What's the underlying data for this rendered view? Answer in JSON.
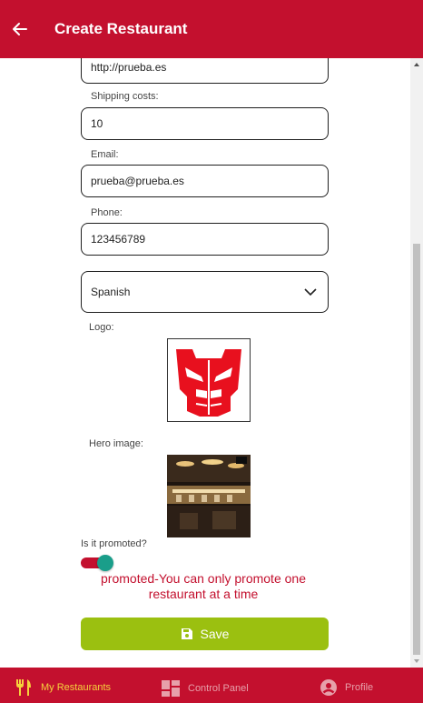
{
  "header": {
    "title": "Create Restaurant"
  },
  "form": {
    "url_value": "http://prueba.es",
    "shipping_label": "Shipping costs:",
    "shipping_value": "10",
    "email_label": "Email:",
    "email_value": "prueba@prueba.es",
    "phone_label": "Phone:",
    "phone_value": "123456789",
    "category_value": "Spanish",
    "logo_label": "Logo:",
    "hero_label": "Hero image:",
    "promoted_label": "Is it promoted?",
    "promoted_on": true,
    "promoted_message": "promoted-You can only promote one restaurant at a time",
    "save_label": "Save"
  },
  "tabs": [
    {
      "label": "My Restaurants",
      "icon": "fork-knife-icon",
      "active": true
    },
    {
      "label": "Control Panel",
      "icon": "dashboard-icon",
      "active": false
    },
    {
      "label": "Profile",
      "icon": "user-circle-icon",
      "active": false
    }
  ],
  "colors": {
    "primary": "#c3102e",
    "save": "#9bc010",
    "active_tab": "#f6d23c",
    "toggle_knob": "#1a9e8a"
  }
}
